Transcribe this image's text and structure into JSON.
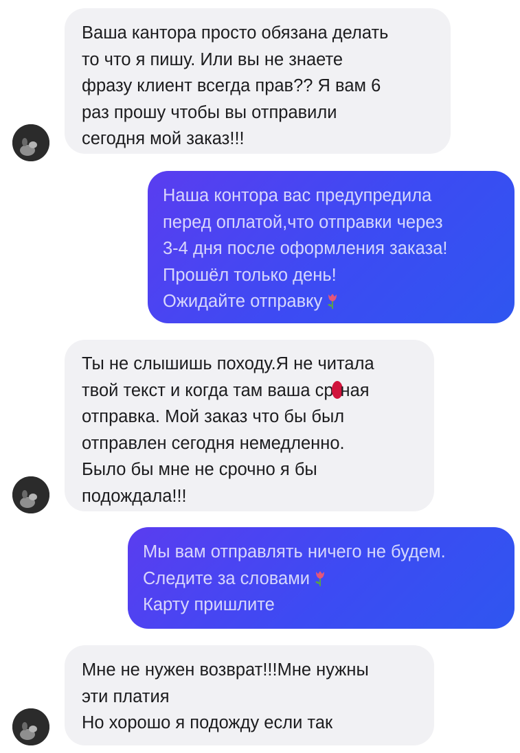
{
  "messages": [
    {
      "direction": "incoming",
      "lines": [
        "Ваша кантора просто обязана делать",
        "то что я пишу. Или вы не знаете",
        "фразу клиент всегда прав?? Я вам 6",
        "раз прошу чтобы вы отправили",
        "сегодня мой заказ!!!"
      ]
    },
    {
      "direction": "outgoing",
      "lines": [
        "Наша контора вас предупредила",
        "перед оплатой,что отправки через",
        "3-4 дня после оформления заказа!",
        "Прошёл только день!",
        "Ожидайте отправку"
      ],
      "trailing_icon": "tulip-emoji"
    },
    {
      "direction": "incoming",
      "lines": [
        "Ты не слышишь походу.Я не читала",
        "твой текст и когда там ваша ср",
        "отправка. Мой заказ что бы был",
        "отправлен сегодня немедленно.",
        "Было бы мне не срочно я бы",
        "подождала!!!"
      ],
      "line2_after_mark": "ная"
    },
    {
      "direction": "outgoing",
      "lines": [
        "Мы вам отправлять ничего не будем.",
        "Следите за словами",
        "Карту пришлите"
      ],
      "trailing_icon": "tulip-emoji"
    },
    {
      "direction": "incoming",
      "lines": [
        "Мне не нужен возврат!!!Мне нужны",
        "эти платия",
        "Но хорошо я подожду если так"
      ]
    }
  ],
  "colors": {
    "incoming_bubble": "#f1f1f4",
    "outgoing_bubble": "#3c4bf3",
    "redaction_mark": "#d0143c"
  }
}
